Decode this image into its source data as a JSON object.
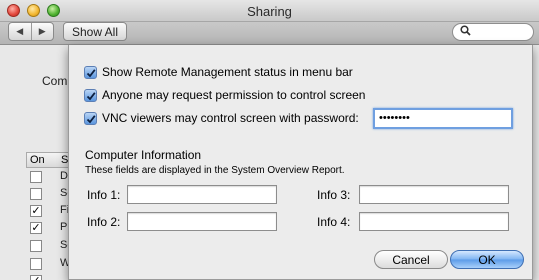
{
  "window": {
    "title": "Sharing"
  },
  "toolbar": {
    "show_all": "Show All",
    "back_glyph": "◀",
    "forward_glyph": "▶",
    "search_icon": "search-icon"
  },
  "background": {
    "computer_label": "Com",
    "list_header_on": "On",
    "list_header_service": "S",
    "services": [
      {
        "checked": false,
        "label": "D"
      },
      {
        "checked": false,
        "label": "Scre"
      },
      {
        "checked": true,
        "label": "Fi"
      },
      {
        "checked": true,
        "label": "P"
      },
      {
        "checked": false,
        "label": "Scanner Sharing"
      },
      {
        "checked": false,
        "label": "Web Sharing"
      },
      {
        "checked": true,
        "label": ""
      }
    ]
  },
  "sheet": {
    "options": [
      {
        "label": "Show Remote Management status in menu bar",
        "checked": true
      },
      {
        "label": "Anyone may request permission to control screen",
        "checked": true
      },
      {
        "label": "VNC viewers may control screen with password:",
        "checked": true
      }
    ],
    "password_value": "••••••••",
    "computer_info": {
      "title": "Computer Information",
      "subtitle": "These fields are displayed in the System Overview Report.",
      "fields": [
        {
          "label": "Info 1:",
          "value": ""
        },
        {
          "label": "Info 2:",
          "value": ""
        },
        {
          "label": "Info 3:",
          "value": ""
        },
        {
          "label": "Info 4:",
          "value": ""
        }
      ]
    },
    "buttons": {
      "cancel": "Cancel",
      "ok": "OK"
    }
  },
  "colors": {
    "accent": "#5b9be8",
    "sheet_bg": "#ececec"
  }
}
